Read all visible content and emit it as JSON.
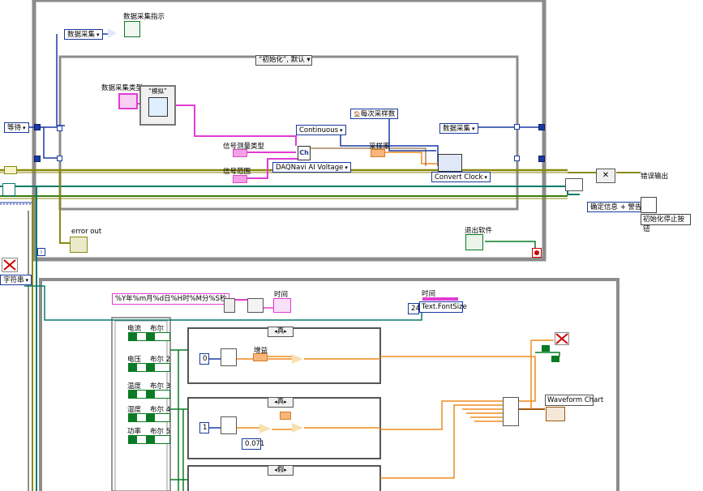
{
  "top_loop": {
    "case_selector": "“初始化”, 默认",
    "indicator_label": "数据采集指示",
    "enum_data_acq": "数据采集",
    "enum_wait": "等待",
    "daq_type_label": "数据采集类型",
    "daq_type_case": "“模拟”",
    "signal_measure_label": "信号测量类型",
    "signal_range_label": "信号范围",
    "continuous": "Continuous",
    "samples_per_read": "每次采样数",
    "sample_rate": "采样率",
    "voltage": "DAQNavi AI Voltage",
    "convert_clock": "Convert Clock",
    "next_state": "数据采集",
    "error_out": "error out",
    "exit_software": "退出软件",
    "error_output": "错误输出",
    "confirm_msg": "确定信息 + 警告",
    "init_stop_button": "初始化停止按钮",
    "iteration": "i"
  },
  "bottom_loop": {
    "string_enum": "字符串",
    "format_string": "%Y年%m月%d日%H时%M分%S秒",
    "time_label": "时间",
    "time2_label": "时间",
    "font_const": "24",
    "font_prop": "Text.FontSize",
    "case1": "真",
    "case2": "真",
    "case3": "假",
    "gain_label": "增益",
    "const_zero": "0",
    "const_one": "1",
    "const_071": "0.071",
    "waveform_chart": "Waveform Chart",
    "channels": [
      {
        "name": "电流",
        "bool": "布尔"
      },
      {
        "name": "电压",
        "bool": "布尔 2"
      },
      {
        "name": "温度",
        "bool": "布尔 3"
      },
      {
        "name": "湿度",
        "bool": "布尔 4"
      },
      {
        "name": "功率",
        "bool": "布尔 5"
      }
    ]
  },
  "colors": {
    "structure_border": "#8c8c8c",
    "wire_blue": "#1a3aa6",
    "wire_pink": "#e13cd3",
    "wire_orange": "#f08c1e",
    "wire_green": "#0a7a25",
    "wire_olive": "#7a7a00"
  }
}
